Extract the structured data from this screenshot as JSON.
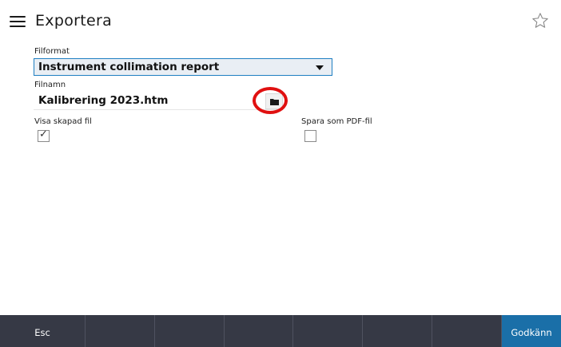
{
  "header": {
    "title": "Exportera",
    "menu_icon": "hamburger-icon",
    "favorite_icon": "star-icon"
  },
  "form": {
    "file_format": {
      "label": "Filformat",
      "selected": "Instrument collimation report"
    },
    "file_name": {
      "label": "Filnamn",
      "value": "Kalibrering 2023.htm",
      "browse_icon": "folder-icon"
    },
    "show_created_file": {
      "label": "Visa skapad fil",
      "checked": true,
      "check_glyph": "✓"
    },
    "save_as_pdf": {
      "label": "Spara som PDF-fil",
      "checked": false
    }
  },
  "footer": {
    "esc_label": "Esc",
    "accept_label": "Godkänn"
  },
  "colors": {
    "accent": "#1f7fc2",
    "footer_bg": "#363945",
    "accept_bg": "#1a6fa8",
    "highlight_ring": "#e01010"
  }
}
